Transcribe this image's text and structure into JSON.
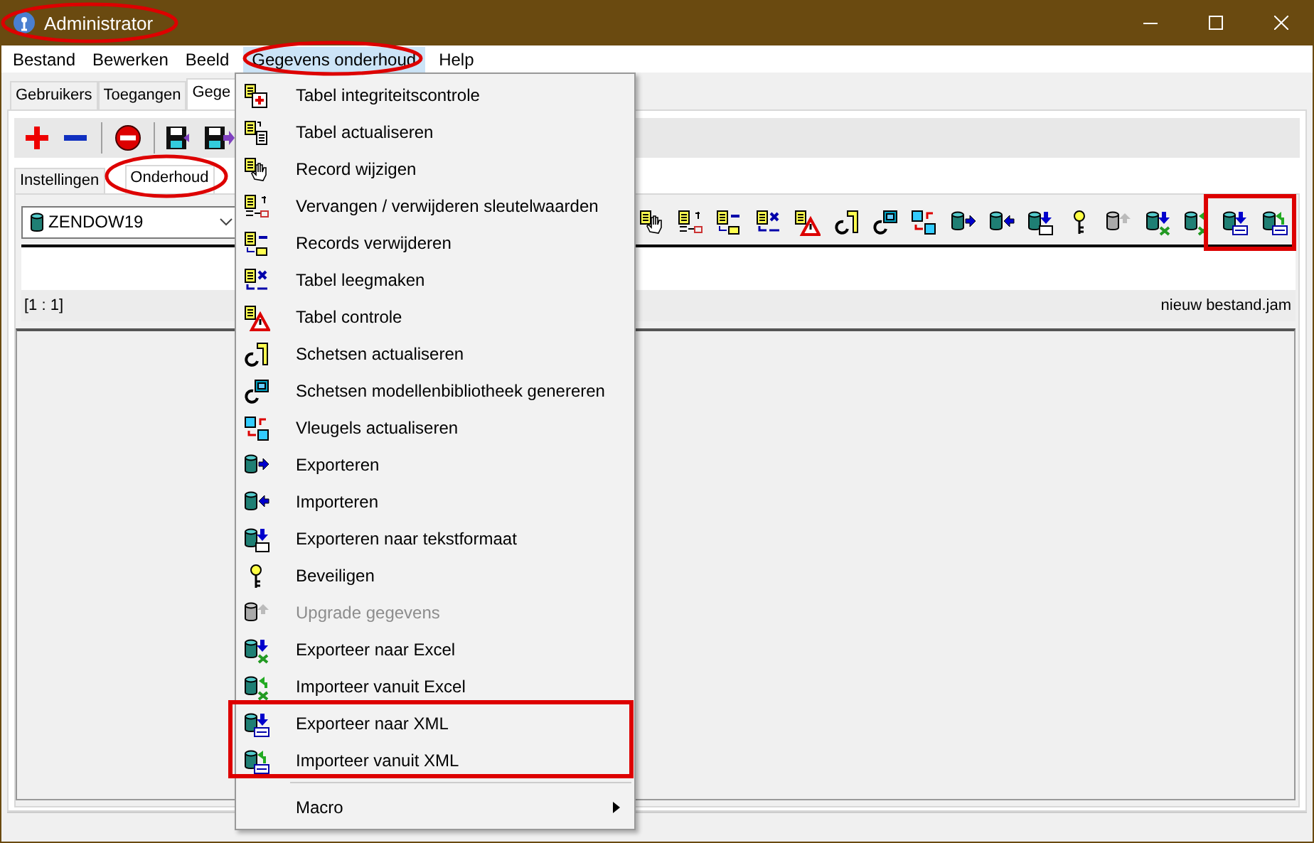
{
  "window": {
    "title": "Administrator"
  },
  "menu_bar": [
    {
      "label": "Bestand",
      "selected": false
    },
    {
      "label": "Bewerken",
      "selected": false
    },
    {
      "label": "Beeld",
      "selected": false
    },
    {
      "label": "Gegevens onderhoud",
      "selected": true
    },
    {
      "label": "Help",
      "selected": false
    }
  ],
  "tabs": [
    {
      "label": "Gebruikers",
      "selected": false
    },
    {
      "label": "Toegangen",
      "selected": false
    },
    {
      "label": "Gege",
      "selected": true
    }
  ],
  "sub_tabs": [
    {
      "label": "Instellingen",
      "selected": false
    },
    {
      "label": "Onderhoud",
      "selected": true
    }
  ],
  "database_select": {
    "value": "ZENDOW19"
  },
  "grid_status": {
    "position": "[1 : 1]",
    "file": "nieuw bestand.jam"
  },
  "dropdown_menu": {
    "items": [
      {
        "kind": "command",
        "label": "Tabel integriteitscontrole",
        "disabled": false
      },
      {
        "kind": "command",
        "label": "Tabel actualiseren",
        "disabled": false
      },
      {
        "kind": "command",
        "label": "Record wijzigen",
        "disabled": false
      },
      {
        "kind": "command",
        "label": "Vervangen / verwijderen sleutelwaarden",
        "disabled": false
      },
      {
        "kind": "command",
        "label": "Records verwijderen",
        "disabled": false
      },
      {
        "kind": "command",
        "label": "Tabel leegmaken",
        "disabled": false
      },
      {
        "kind": "command",
        "label": "Tabel controle",
        "disabled": false
      },
      {
        "kind": "command",
        "label": "Schetsen actualiseren",
        "disabled": false
      },
      {
        "kind": "command",
        "label": "Schetsen modellenbibliotheek genereren",
        "disabled": false
      },
      {
        "kind": "command",
        "label": "Vleugels actualiseren",
        "disabled": false
      },
      {
        "kind": "command",
        "label": "Exporteren",
        "disabled": false
      },
      {
        "kind": "command",
        "label": "Importeren",
        "disabled": false
      },
      {
        "kind": "command",
        "label": "Exporteren naar tekstformaat",
        "disabled": false
      },
      {
        "kind": "command",
        "label": "Beveiligen",
        "disabled": false
      },
      {
        "kind": "command",
        "label": "Upgrade gegevens",
        "disabled": true
      },
      {
        "kind": "command",
        "label": "Exporteer naar Excel",
        "disabled": false
      },
      {
        "kind": "command",
        "label": "Importeer vanuit Excel",
        "disabled": false
      },
      {
        "kind": "command",
        "label": "Exporteer naar XML",
        "disabled": false
      },
      {
        "kind": "command",
        "label": "Importeer vanuit XML",
        "disabled": false
      },
      {
        "kind": "separator"
      },
      {
        "kind": "submenu",
        "label": "Macro",
        "disabled": false
      }
    ]
  }
}
